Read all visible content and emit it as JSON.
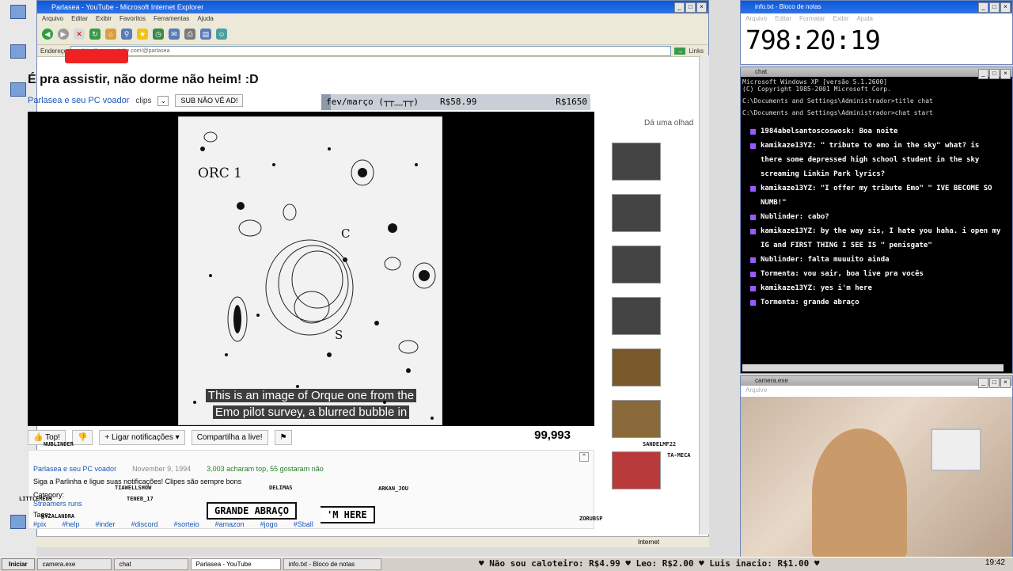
{
  "ie": {
    "title": "Parlasea - YouTube - Microsoft Internet Explorer",
    "menu": [
      "Arquivo",
      "Editar",
      "Exibir",
      "Favoritos",
      "Ferramentas",
      "Ajuda"
    ],
    "address_label": "Endereço",
    "address_value": "http://www.youtube.com/@parlasea",
    "links_label": "Links",
    "status": "Internet"
  },
  "video": {
    "title": "É pra assistir, não dorme não heim! :D",
    "channel": "Parlasea e seu PC voador",
    "clips_label": "clips",
    "sub_label": "SUB NÃO VÊ AD!",
    "goal_label": "fev/março (┬┬﹏┬┬)",
    "goal_value": "R$58.99",
    "goal_target": "R$1650",
    "goal_progress": 0.036,
    "caption_line1": "This is an image of Orque one from the",
    "caption_line2": "Emo pilot survey, a blurred bubble in",
    "astro_label": "ORC 1",
    "astro_c": "C",
    "astro_s": "S",
    "top_label": "Top!",
    "notify_label": "Ligar notificações",
    "share_label": "Compartilha a live!",
    "views": "99,993",
    "sidebar_heading": "Dá uma olhad"
  },
  "description": {
    "channel": "Parlasea e seu PC voador",
    "date": "November 9, 1994",
    "likes": "3,003 acharam top, 55 gostaram não",
    "text": "Siga a Parlinha e ligue suas notificações! Clipes são sempre bons",
    "category_label": "Category:",
    "category_value": "Streamers runs",
    "tags_label": "Tags:",
    "tags": [
      "#pix",
      "#help",
      "#inder",
      "#discord",
      "#sorteio",
      "#amazon",
      "#jogo",
      "#Sball"
    ]
  },
  "notepad": {
    "title": "info.txt - Bloco de notas",
    "menu": [
      "Arquivo",
      "Editar",
      "Formatar",
      "Exibir",
      "Ajuda"
    ],
    "timer": "798:20:19"
  },
  "chat": {
    "title": "chat",
    "header": [
      "Microsoft Windows XP [versão 5.1.2600]",
      "(C) Copyright 1985-2001 Microsoft Corp.",
      "",
      "C:\\Documents and Settings\\Administrador>title chat",
      "",
      "C:\\Documents and Settings\\Administrador>chat start"
    ],
    "messages": [
      {
        "user": "1984abelsantoscoswosk:",
        "text": "Boa noite"
      },
      {
        "user": "kamikaze13YZ:",
        "text": "\" tribute to emo in the sky\" what? is there some depressed high school student in the sky screaming Linkin Park lyrics?"
      },
      {
        "user": "kamikaze13YZ:",
        "text": "\"I offer my tribute Emo\" \" IVE BECOME SO NUMB!\""
      },
      {
        "user": "Nublinder:",
        "text": "cabo?"
      },
      {
        "user": "kamikaze13YZ:",
        "text": "by the way sis, I hate you haha. i open my IG and FIRST THING I SEE IS \" penisgate\""
      },
      {
        "user": "Nublinder:",
        "text": "falta muuuito ainda"
      },
      {
        "user": "Tormenta:",
        "text": "vou sair, boa live pra vocês"
      },
      {
        "user": "kamikaze13YZ:",
        "text": "yes i'm here"
      },
      {
        "user": "Tormenta:",
        "text": "grande abraço"
      }
    ]
  },
  "camera": {
    "title": "camera.exe",
    "menu": "Arquivo"
  },
  "overlay": {
    "speech1": "GRANDE ABRAÇO",
    "speech2": "'M HERE",
    "names": [
      "NUBLINDER",
      "TIAWELLSHOW",
      "DELIMAS",
      "ARKAN_JOU",
      "LITTLEMEBS",
      "TENEB_17",
      "KYZALANDRA",
      "ZORUBSP",
      "SANDELMF22",
      "TA-MECA"
    ]
  },
  "taskbar": {
    "start": "Iniciar",
    "tasks": [
      "camera.exe",
      "chat",
      "Parlasea - YouTube",
      "info.txt - Bloco de notas"
    ],
    "ticker": "♥ Não sou caloteiro: R$4.99 ♥ Leo: R$2.00 ♥ Luis inacio: R$1.00 ♥",
    "clock": "19:42"
  }
}
